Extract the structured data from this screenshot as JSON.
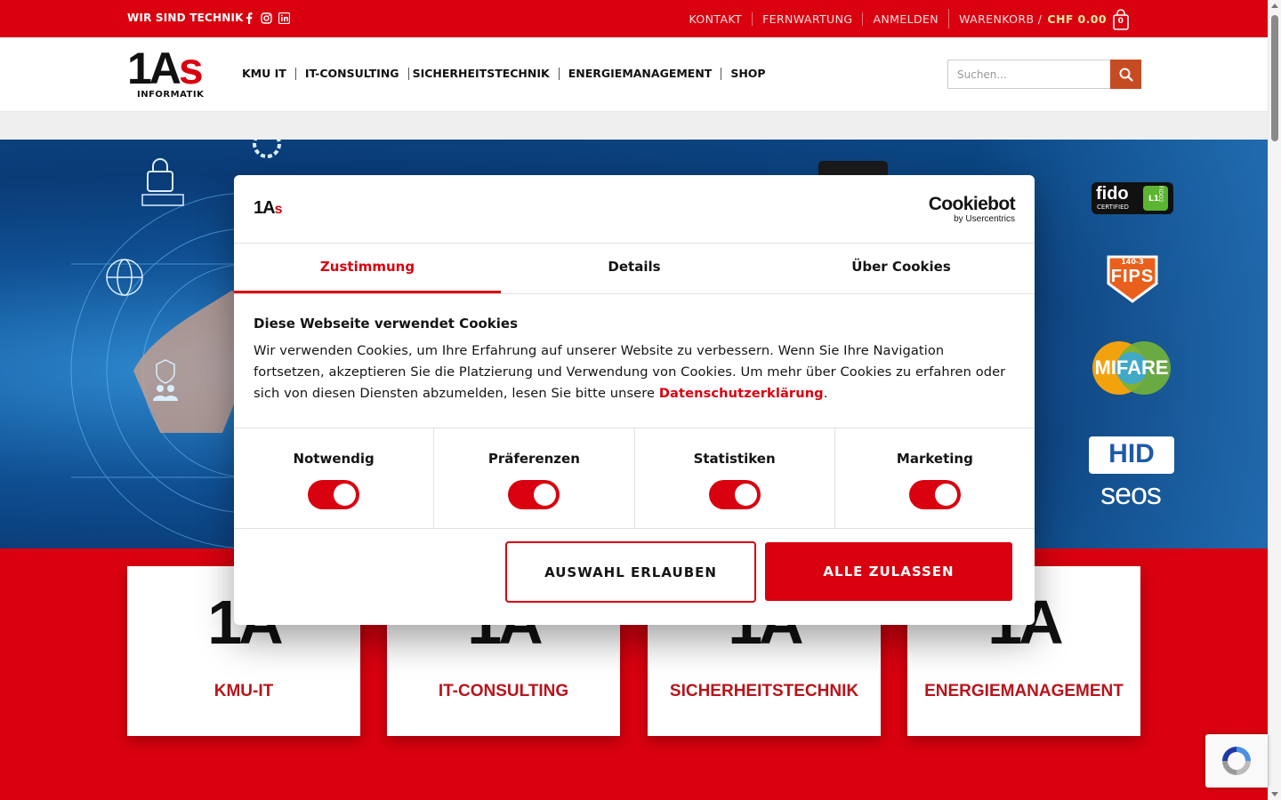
{
  "topbar": {
    "tagline": "WIR SIND TECHNIK",
    "social_icons": [
      "facebook-icon",
      "instagram-icon",
      "linkedin-icon"
    ],
    "links": [
      "KONTAKT",
      "FERNWARTUNG",
      "ANMELDEN"
    ],
    "cart_label": "WARENKORB /",
    "cart_price": "CHF 0.00",
    "cart_count": "0"
  },
  "header": {
    "logo_main": "1A",
    "logo_s": "s",
    "logo_sub": "INFORMATIK",
    "nav": [
      "KMU IT",
      "IT-CONSULTING",
      "SICHERHEITSTECHNIK",
      "ENERGIEMANAGEMENT",
      "SHOP"
    ],
    "search_placeholder": "Suchen..."
  },
  "hero": {
    "badges": [
      "fido",
      "FIPS",
      "MIFARE",
      "HID",
      "seos"
    ],
    "fips_top": "140-3",
    "fido_sub": "CERTIFIED",
    "fido_side": "FIDO2",
    "fido_l1": "L1"
  },
  "cards": [
    {
      "num": "1A",
      "label": "KMU-IT"
    },
    {
      "num": "1A",
      "label": "IT-CONSULTING"
    },
    {
      "num": "1A",
      "label": "SICHERHEITSTECHNIK"
    },
    {
      "num": "1A",
      "label": "ENERGIEMANAGEMENT"
    }
  ],
  "cookie": {
    "logo_main": "1A",
    "logo_s": "s",
    "brand": "Cookiebot",
    "brand_sub": "by Usercentrics",
    "tabs": [
      "Zustimmung",
      "Details",
      "Über Cookies"
    ],
    "heading": "Diese Webseite verwendet Cookies",
    "text": "Wir verwenden Cookies, um Ihre Erfahrung auf unserer Website zu verbessern. Wenn Sie Ihre Navigation fortsetzen, akzeptieren Sie die Platzierung und Verwendung von Cookies. Um mehr über Cookies zu erfahren oder sich von diesen Diensten abzumelden, lesen Sie bitte unsere ",
    "link": "Datenschutzerklärung",
    "text_end": ".",
    "categories": [
      {
        "label": "Notwendig",
        "enabled": true
      },
      {
        "label": "Präferenzen",
        "enabled": true
      },
      {
        "label": "Statistiken",
        "enabled": true
      },
      {
        "label": "Marketing",
        "enabled": true
      }
    ],
    "btn_selection": "AUSWAHL ERLAUBEN",
    "btn_all": "ALLE ZULASSEN"
  },
  "colors": {
    "brand_red": "#d9000f",
    "search_button": "#c74b22",
    "card_label": "#b8141b"
  }
}
